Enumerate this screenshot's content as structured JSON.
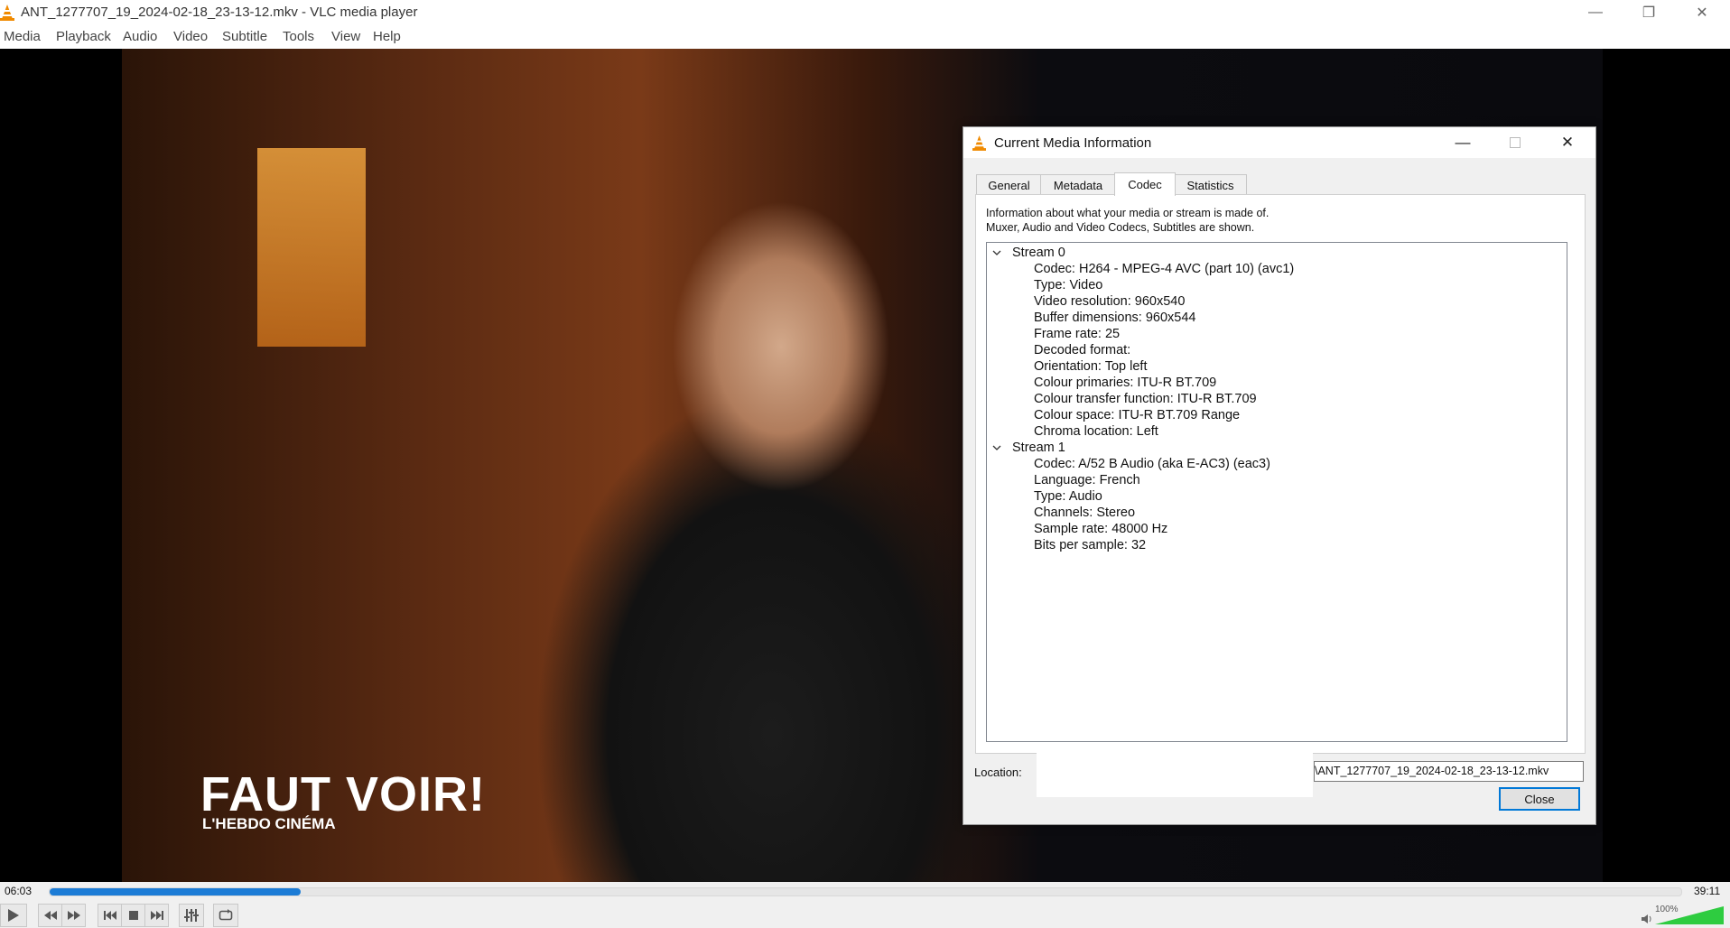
{
  "window": {
    "title": "ANT_1277707_19_2024-02-18_23-13-12.mkv - VLC media player",
    "controls": {
      "minimize": "—",
      "restore": "❐",
      "close": "✕"
    }
  },
  "menu": [
    "Media",
    "Playback",
    "Audio",
    "Video",
    "Subtitle",
    "Tools",
    "View",
    "Help"
  ],
  "video_overlay": {
    "logo_line1": "FAUT VOIR!",
    "logo_line2": "L'HEBDO CINÉMA"
  },
  "dialog": {
    "title": "Current Media Information",
    "tabs": [
      "General",
      "Metadata",
      "Codec",
      "Statistics"
    ],
    "active_tab": "Codec",
    "description_line1": "Information about what your media or stream is made of.",
    "description_line2": "Muxer, Audio and Video Codecs, Subtitles are shown.",
    "streams": [
      {
        "label": "Stream 0",
        "items": [
          "Codec: H264 - MPEG-4 AVC (part 10) (avc1)",
          "Type: Video",
          "Video resolution: 960x540",
          "Buffer dimensions: 960x544",
          "Frame rate: 25",
          "Decoded format:",
          "Orientation: Top left",
          "Colour primaries: ITU-R BT.709",
          "Colour transfer function: ITU-R BT.709",
          "Colour space: ITU-R BT.709 Range",
          "Chroma location: Left"
        ]
      },
      {
        "label": "Stream 1",
        "items": [
          "Codec: A/52 B Audio (aka E-AC3) (eac3)",
          "Language: French",
          "Type: Audio",
          "Channels: Stereo",
          "Sample rate: 48000 Hz",
          "Bits per sample: 32"
        ]
      }
    ],
    "location_label": "Location:",
    "location_value": "\\ANT_1277707_19_2024-02-18_23-13-12.mkv",
    "close_label": "Close"
  },
  "player": {
    "elapsed": "06:03",
    "total": "39:11",
    "progress_fraction": 0.154,
    "volume_label": "100%",
    "volume_fraction": 1.0,
    "accent_color": "#1c7cd6",
    "volume_color": "#2ecc40"
  }
}
